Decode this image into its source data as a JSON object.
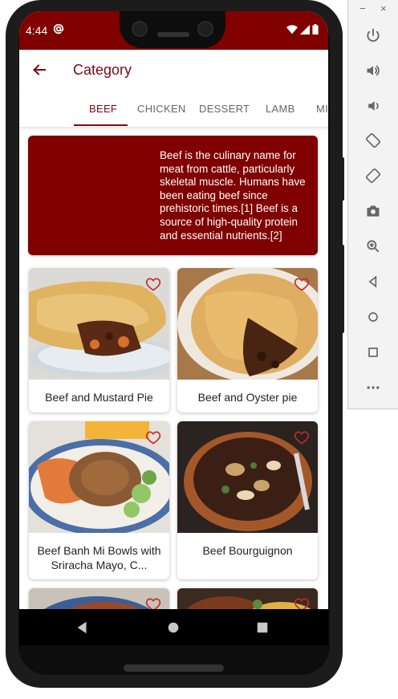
{
  "status_bar": {
    "time": "4:44",
    "at_icon": "at-sign-icon",
    "icons": [
      "wifi-icon",
      "signal-icon",
      "battery-icon"
    ],
    "background": "#800000"
  },
  "app_bar": {
    "title": "Category",
    "back_icon": "back-arrow-icon"
  },
  "tabs": [
    {
      "label": "BEEF",
      "active": true
    },
    {
      "label": "CHICKEN",
      "active": false
    },
    {
      "label": "DESSERT",
      "active": false
    },
    {
      "label": "LAMB",
      "active": false
    },
    {
      "label": "MI",
      "active": false
    }
  ],
  "category_description": "Beef is the culinary name for meat from cattle, particularly skeletal muscle. Humans have been eating beef since prehistoric times.[1] Beef is a source of high-quality protein and essential nutrients.[2]",
  "meals": [
    {
      "title": "Beef and Mustard Pie",
      "icon": "heart-outline-icon"
    },
    {
      "title": "Beef and Oyster pie",
      "icon": "heart-outline-icon"
    },
    {
      "title": "Beef Banh Mi Bowls with Sriracha Mayo, C...",
      "icon": "heart-outline-icon"
    },
    {
      "title": "Beef Bourguignon",
      "icon": "heart-outline-icon"
    },
    {
      "title": "",
      "icon": "heart-outline-icon"
    },
    {
      "title": "",
      "icon": "heart-outline-icon"
    }
  ],
  "nav_bar": {
    "icons": [
      "back-triangle-icon",
      "home-circle-icon",
      "recents-square-icon"
    ]
  },
  "emulator_panel": {
    "window_controls": [
      "−",
      "×"
    ],
    "icons": [
      "power-icon",
      "volume-up-icon",
      "volume-down-icon",
      "rotate-left-icon",
      "rotate-right-icon",
      "camera-icon",
      "zoom-icon",
      "back-icon",
      "home-icon",
      "overview-icon",
      "more-icon"
    ]
  },
  "colors": {
    "brand": "#800000",
    "title": "#7a0a14",
    "heart": "#c62828"
  }
}
